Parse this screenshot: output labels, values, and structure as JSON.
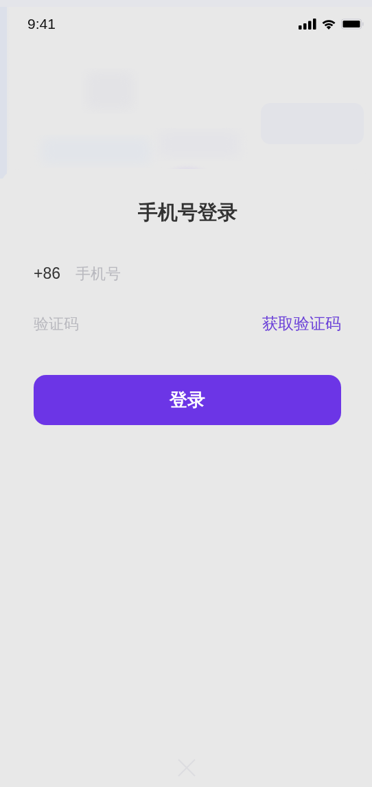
{
  "status_bar": {
    "time": "9:41"
  },
  "login": {
    "title": "手机号登录",
    "phone": {
      "prefix": "+86",
      "placeholder": "手机号"
    },
    "code": {
      "placeholder": "验证码",
      "action": "获取验证码"
    },
    "submit": "登录"
  }
}
